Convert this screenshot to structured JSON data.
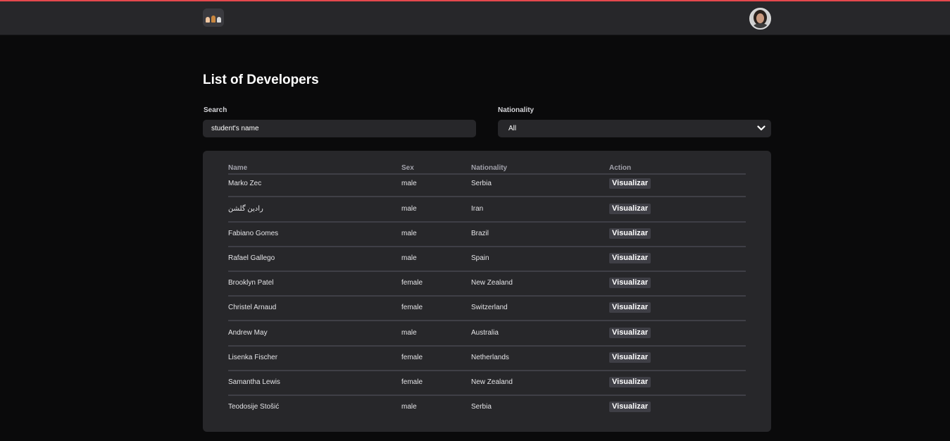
{
  "header": {
    "logo_icon": "team-icon",
    "avatar_icon": "user-avatar",
    "accent_color": "#e5484d"
  },
  "page": {
    "title": "List of Developers"
  },
  "filters": {
    "search_label": "Search",
    "search_value": "student's name",
    "nationality_label": "Nationality",
    "nationality_value": "All"
  },
  "table": {
    "columns": [
      "Name",
      "Sex",
      "Nationality",
      "Action"
    ],
    "action_label": "Visualizar",
    "rows": [
      {
        "name": "Marko Zec",
        "sex": "male",
        "nationality": "Serbia"
      },
      {
        "name": "رادین گلشن",
        "sex": "male",
        "nationality": "Iran"
      },
      {
        "name": "Fabiano Gomes",
        "sex": "male",
        "nationality": "Brazil"
      },
      {
        "name": "Rafael Gallego",
        "sex": "male",
        "nationality": "Spain"
      },
      {
        "name": "Brooklyn Patel",
        "sex": "female",
        "nationality": "New Zealand"
      },
      {
        "name": "Christel Arnaud",
        "sex": "female",
        "nationality": "Switzerland"
      },
      {
        "name": "Andrew May",
        "sex": "male",
        "nationality": "Australia"
      },
      {
        "name": "Lisenka Fischer",
        "sex": "female",
        "nationality": "Netherlands"
      },
      {
        "name": "Samantha Lewis",
        "sex": "female",
        "nationality": "New Zealand"
      },
      {
        "name": "Teodosije Stošić",
        "sex": "male",
        "nationality": "Serbia"
      }
    ]
  }
}
